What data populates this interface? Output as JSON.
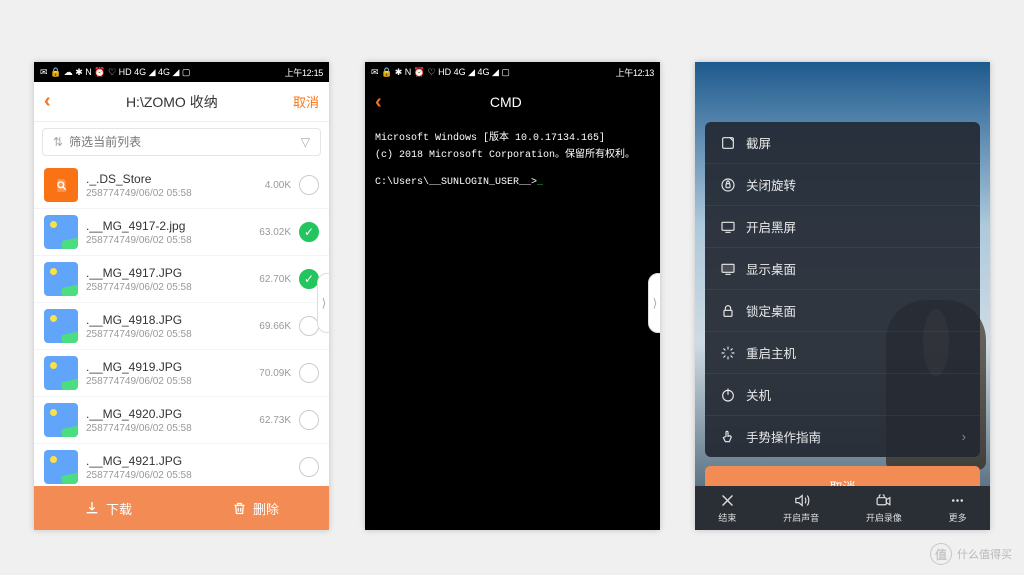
{
  "watermark": "什么值得买",
  "phone1": {
    "status": {
      "time": "上午12:15",
      "icons": "✉ 🔒 ☁  ✱ N ⏰ ♡ HD 4G ◢ 4G ◢ ▢"
    },
    "header": {
      "title": "H:\\ZOMO 收纳",
      "cancel": "取消"
    },
    "filter": {
      "placeholder": "筛选当前列表"
    },
    "files": [
      {
        "name": "._.DS_Store",
        "meta": "258774749/06/02 05:58",
        "size": "4.00K",
        "checked": false,
        "type": "doc"
      },
      {
        "name": ".__MG_4917-2.jpg",
        "meta": "258774749/06/02 05:58",
        "size": "63.02K",
        "checked": true,
        "type": "img"
      },
      {
        "name": ".__MG_4917.JPG",
        "meta": "258774749/06/02 05:58",
        "size": "62.70K",
        "checked": true,
        "type": "img"
      },
      {
        "name": ".__MG_4918.JPG",
        "meta": "258774749/06/02 05:58",
        "size": "69.66K",
        "checked": false,
        "type": "img"
      },
      {
        "name": ".__MG_4919.JPG",
        "meta": "258774749/06/02 05:58",
        "size": "70.09K",
        "checked": false,
        "type": "img"
      },
      {
        "name": ".__MG_4920.JPG",
        "meta": "258774749/06/02 05:58",
        "size": "62.73K",
        "checked": false,
        "type": "img"
      },
      {
        "name": ".__MG_4921.JPG",
        "meta": "258774749/06/02 05:58",
        "size": "",
        "checked": false,
        "type": "img"
      }
    ],
    "bottom": {
      "download": "下载",
      "delete": "删除"
    }
  },
  "phone2": {
    "status": {
      "time": "上午12:13",
      "icons": "✉ 🔒  ✱ N ⏰ ♡ HD 4G ◢ 4G ◢ ▢"
    },
    "header": {
      "title": "CMD"
    },
    "terminal": {
      "l1": "Microsoft Windows [版本 10.0.17134.165]",
      "l2": "(c) 2018 Microsoft Corporation。保留所有权利。",
      "l3": "C:\\Users\\__SUNLOGIN_USER__>",
      "cursor": "_"
    }
  },
  "phone3": {
    "menu": [
      {
        "label": "截屏",
        "icon": "screenshot"
      },
      {
        "label": "关闭旋转",
        "icon": "rotate-lock"
      },
      {
        "label": "开启黑屏",
        "icon": "black-screen"
      },
      {
        "label": "显示桌面",
        "icon": "show-desktop"
      },
      {
        "label": "锁定桌面",
        "icon": "lock-desktop"
      },
      {
        "label": "重启主机",
        "icon": "restart"
      },
      {
        "label": "关机",
        "icon": "power"
      },
      {
        "label": "手势操作指南",
        "icon": "gesture",
        "chevron": true
      }
    ],
    "cancel": "取消",
    "bottom": [
      {
        "label": "结束",
        "icon": "close"
      },
      {
        "label": "开启声音",
        "icon": "sound"
      },
      {
        "label": "开启录像",
        "icon": "record"
      },
      {
        "label": "更多",
        "icon": "more"
      }
    ]
  }
}
